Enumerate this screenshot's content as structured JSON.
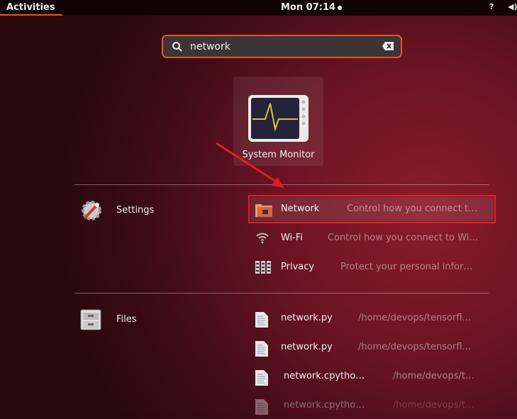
{
  "topbar": {
    "activities": "Activities",
    "clock": "Mon 07:14",
    "tray_icons": [
      "accessibility-icon",
      "volume-icon"
    ]
  },
  "search": {
    "value": "network",
    "icon": "search-icon",
    "clear_icon": "clear-icon"
  },
  "apps": [
    {
      "label": "System Monitor",
      "icon": "system-monitor-icon"
    }
  ],
  "providers": [
    {
      "name": "Settings",
      "icon": "settings-icon",
      "results": [
        {
          "name": "Network",
          "description": "Control how you connect t…",
          "icon": "network-folder-icon",
          "highlighted": true
        },
        {
          "name": "Wi-Fi",
          "description": "Control how you connect to Wi…",
          "icon": "wifi-icon"
        },
        {
          "name": "Privacy",
          "description": "Protect your personal infor…",
          "icon": "privacy-icon"
        }
      ]
    },
    {
      "name": "Files",
      "icon": "file-cabinet-icon",
      "results": [
        {
          "name": "network.py",
          "description": "/home/devops/tensorfl…",
          "icon": "text-file-icon"
        },
        {
          "name": "network.py",
          "description": "/home/devops/tensorfl…",
          "icon": "text-file-icon"
        },
        {
          "name": "network.cpytho…",
          "description": "/home/devops/t…",
          "icon": "text-file-icon"
        },
        {
          "name": "network.cpytho…",
          "description": "/home/devops/t…",
          "icon": "text-file-icon"
        }
      ]
    }
  ],
  "colors": {
    "accent": "#e95420",
    "annotation": "#e51c23"
  }
}
